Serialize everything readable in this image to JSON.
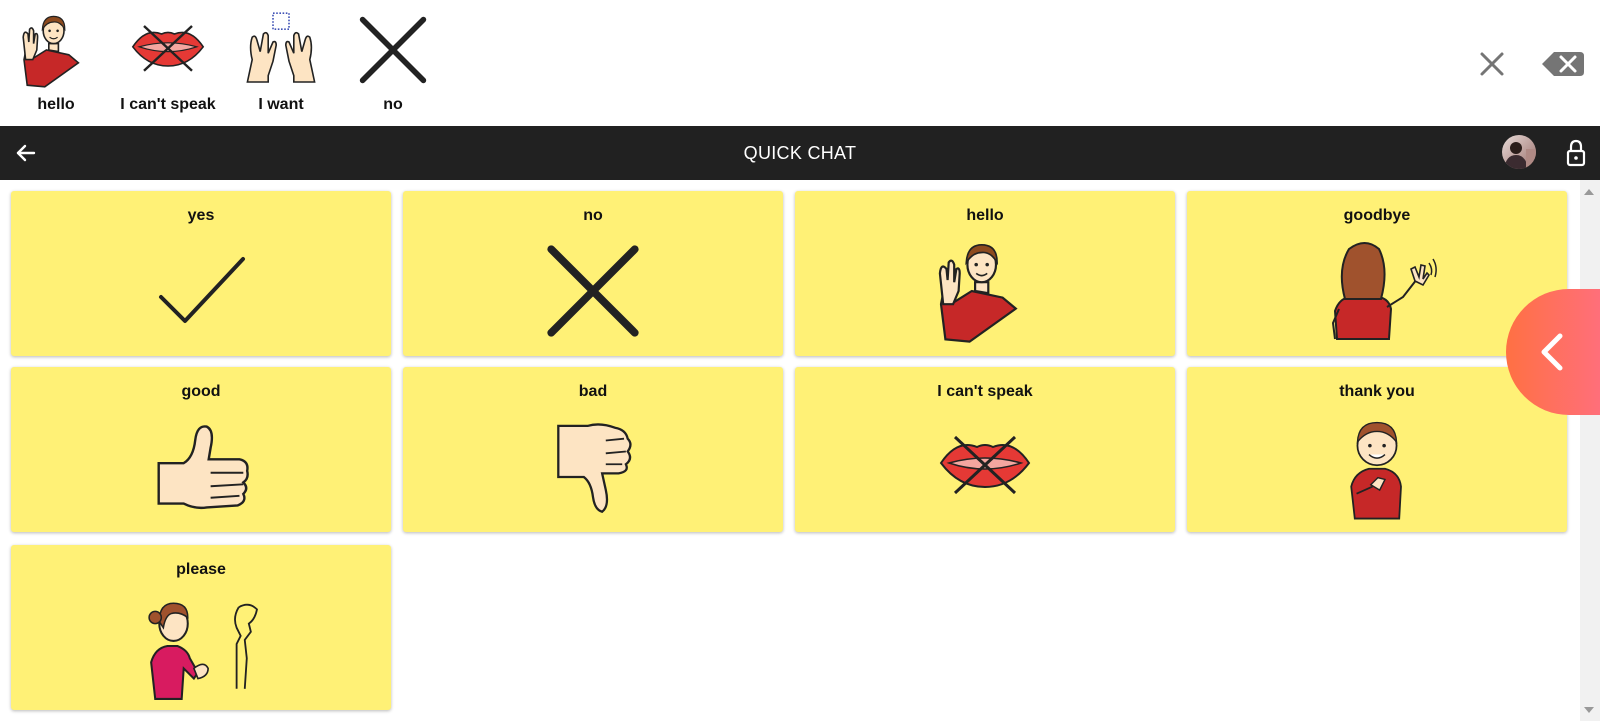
{
  "output_bar": {
    "items": [
      {
        "label": "hello",
        "icon": "waving-person-icon"
      },
      {
        "label": "I can't speak",
        "icon": "crossed-lips-icon"
      },
      {
        "label": "I want",
        "icon": "wanting-hands-icon"
      },
      {
        "label": "no",
        "icon": "cross-icon"
      }
    ],
    "clear_icon": "close-icon",
    "backspace_icon": "backspace-icon"
  },
  "navbar": {
    "title": "QUICK CHAT",
    "back_icon": "arrow-left-icon",
    "lock_icon": "lock-icon"
  },
  "board": {
    "tiles": [
      {
        "label": "yes",
        "icon": "checkmark-icon"
      },
      {
        "label": "no",
        "icon": "cross-icon"
      },
      {
        "label": "hello",
        "icon": "waving-person-icon"
      },
      {
        "label": "goodbye",
        "icon": "waving-goodbye-icon"
      },
      {
        "label": "good",
        "icon": "thumbs-up-icon"
      },
      {
        "label": "bad",
        "icon": "thumbs-down-icon"
      },
      {
        "label": "I can't speak",
        "icon": "crossed-lips-icon"
      },
      {
        "label": "thank you",
        "icon": "thanking-child-icon"
      },
      {
        "label": "please",
        "icon": "pleading-person-icon"
      }
    ]
  },
  "colors": {
    "tile_background": "#fff176",
    "navbar_background": "#212121",
    "side_toggle": "#ff7043"
  }
}
